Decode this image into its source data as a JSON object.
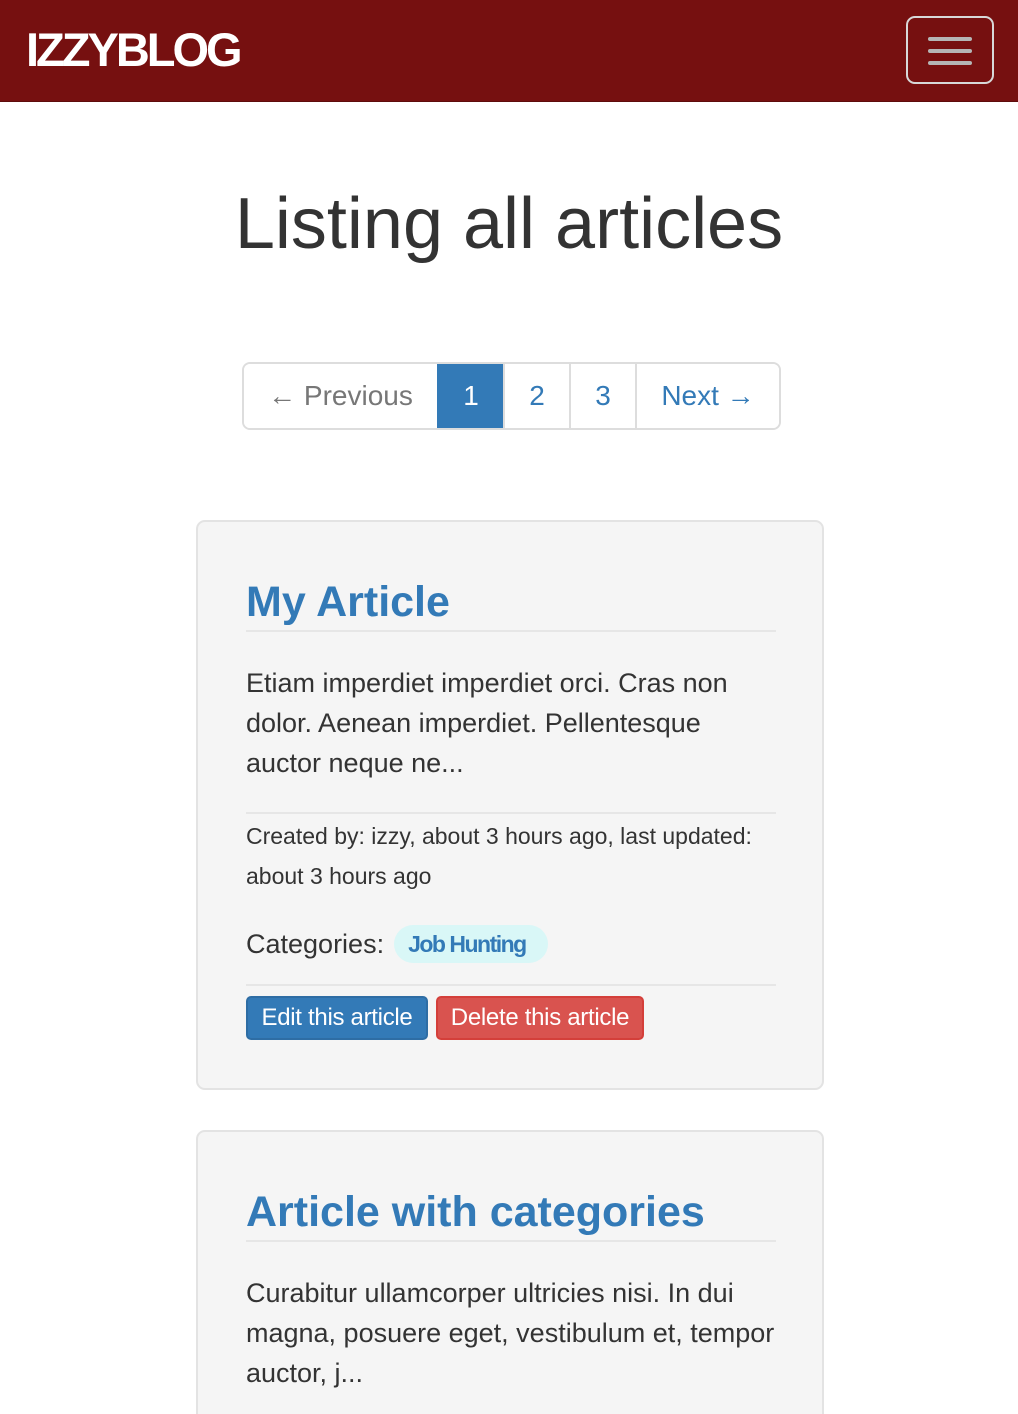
{
  "navbar": {
    "brand": "IZZYBLOG",
    "toggle_icon": "hamburger-menu-icon"
  },
  "page": {
    "title": "Listing all articles"
  },
  "pagination": {
    "previous": "← Previous",
    "pages": [
      "1",
      "2",
      "3"
    ],
    "current": "1",
    "next": "Next →"
  },
  "articles": [
    {
      "title": "My Article",
      "excerpt": "Etiam imperdiet imperdiet orci. Cras non dolor. Aenean imperdiet. Pellentesque auctor neque ne...",
      "meta": "Created by: izzy, about 3 hours ago, last updated: about 3 hours ago",
      "categories_label": "Categories:",
      "categories": [
        "Job Hunting"
      ],
      "edit_label": "Edit this article",
      "delete_label": "Delete this article"
    },
    {
      "title": "Article with categories",
      "excerpt": "Curabitur ullamcorper ultricies nisi. In dui magna, posuere eget, vestibulum et, tempor auctor, j..."
    }
  ],
  "colors": {
    "navbar": "#761010",
    "link": "#337ab7",
    "danger": "#d9534f",
    "card_bg": "#f5f5f5",
    "badge_bg": "#d9f7f7"
  }
}
